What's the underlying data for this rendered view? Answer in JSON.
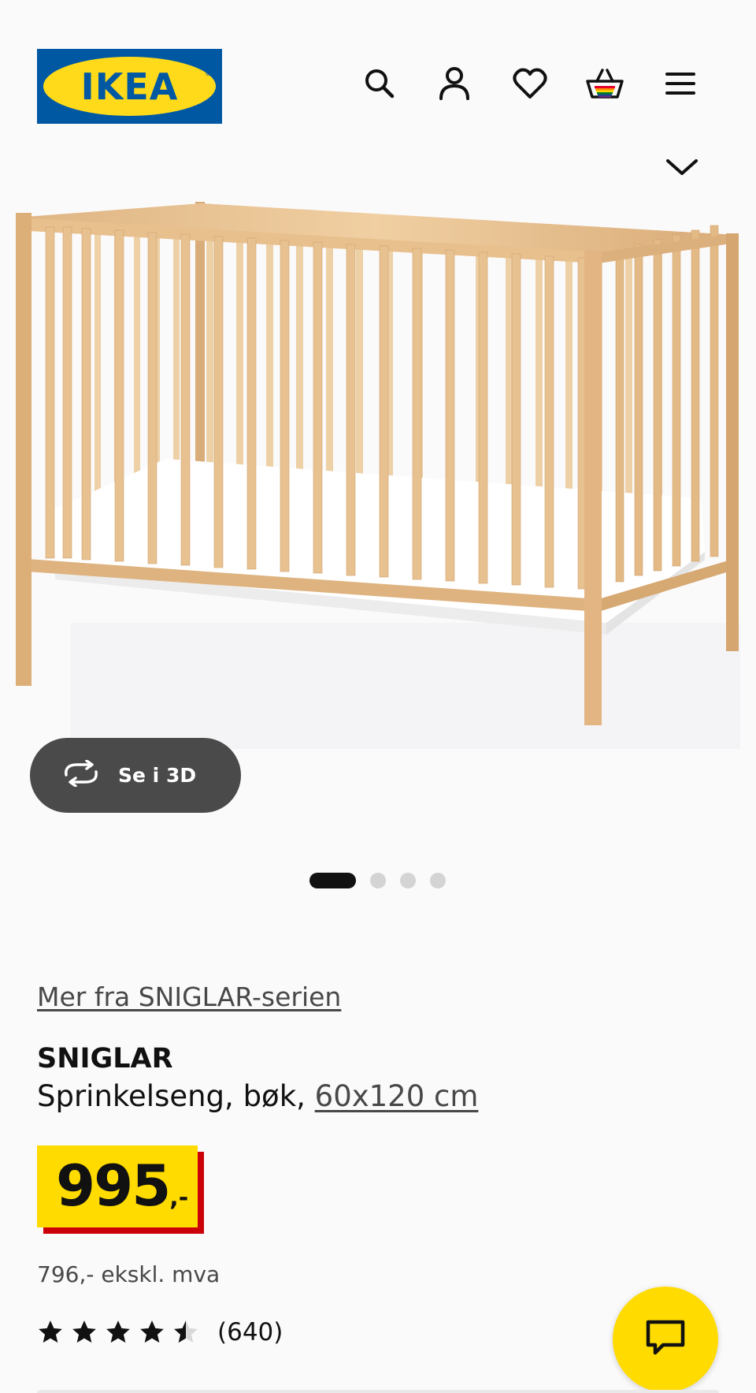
{
  "header": {
    "logo_text": "IKEA",
    "logo_colors": {
      "background": "#0058a3",
      "oval": "#ffda1a"
    },
    "icons": [
      "search-icon",
      "user-icon",
      "heart-icon",
      "basket-icon",
      "menu-icon",
      "chevron-down-icon"
    ]
  },
  "gallery": {
    "image_alt": "SNIGLAR sprinkelseng, bøk",
    "view_3d_label": "Se i 3D",
    "slide_count": 4,
    "active_slide": 1
  },
  "product": {
    "series_link": "Mer fra SNIGLAR-serien",
    "name": "SNIGLAR",
    "description": "Sprinkelseng, bøk,",
    "size_link": "60x120 cm",
    "price": {
      "integer": "995",
      "suffix": ",-",
      "box_color": "#ffdb00",
      "shadow_color": "#cc0008"
    },
    "price_excl_vat": "796,- ekskl. mva",
    "rating": {
      "value": 4.5,
      "max": 5,
      "count_label": "(640)"
    }
  },
  "chat": {
    "icon": "chat-icon",
    "color": "#ffdb00"
  }
}
